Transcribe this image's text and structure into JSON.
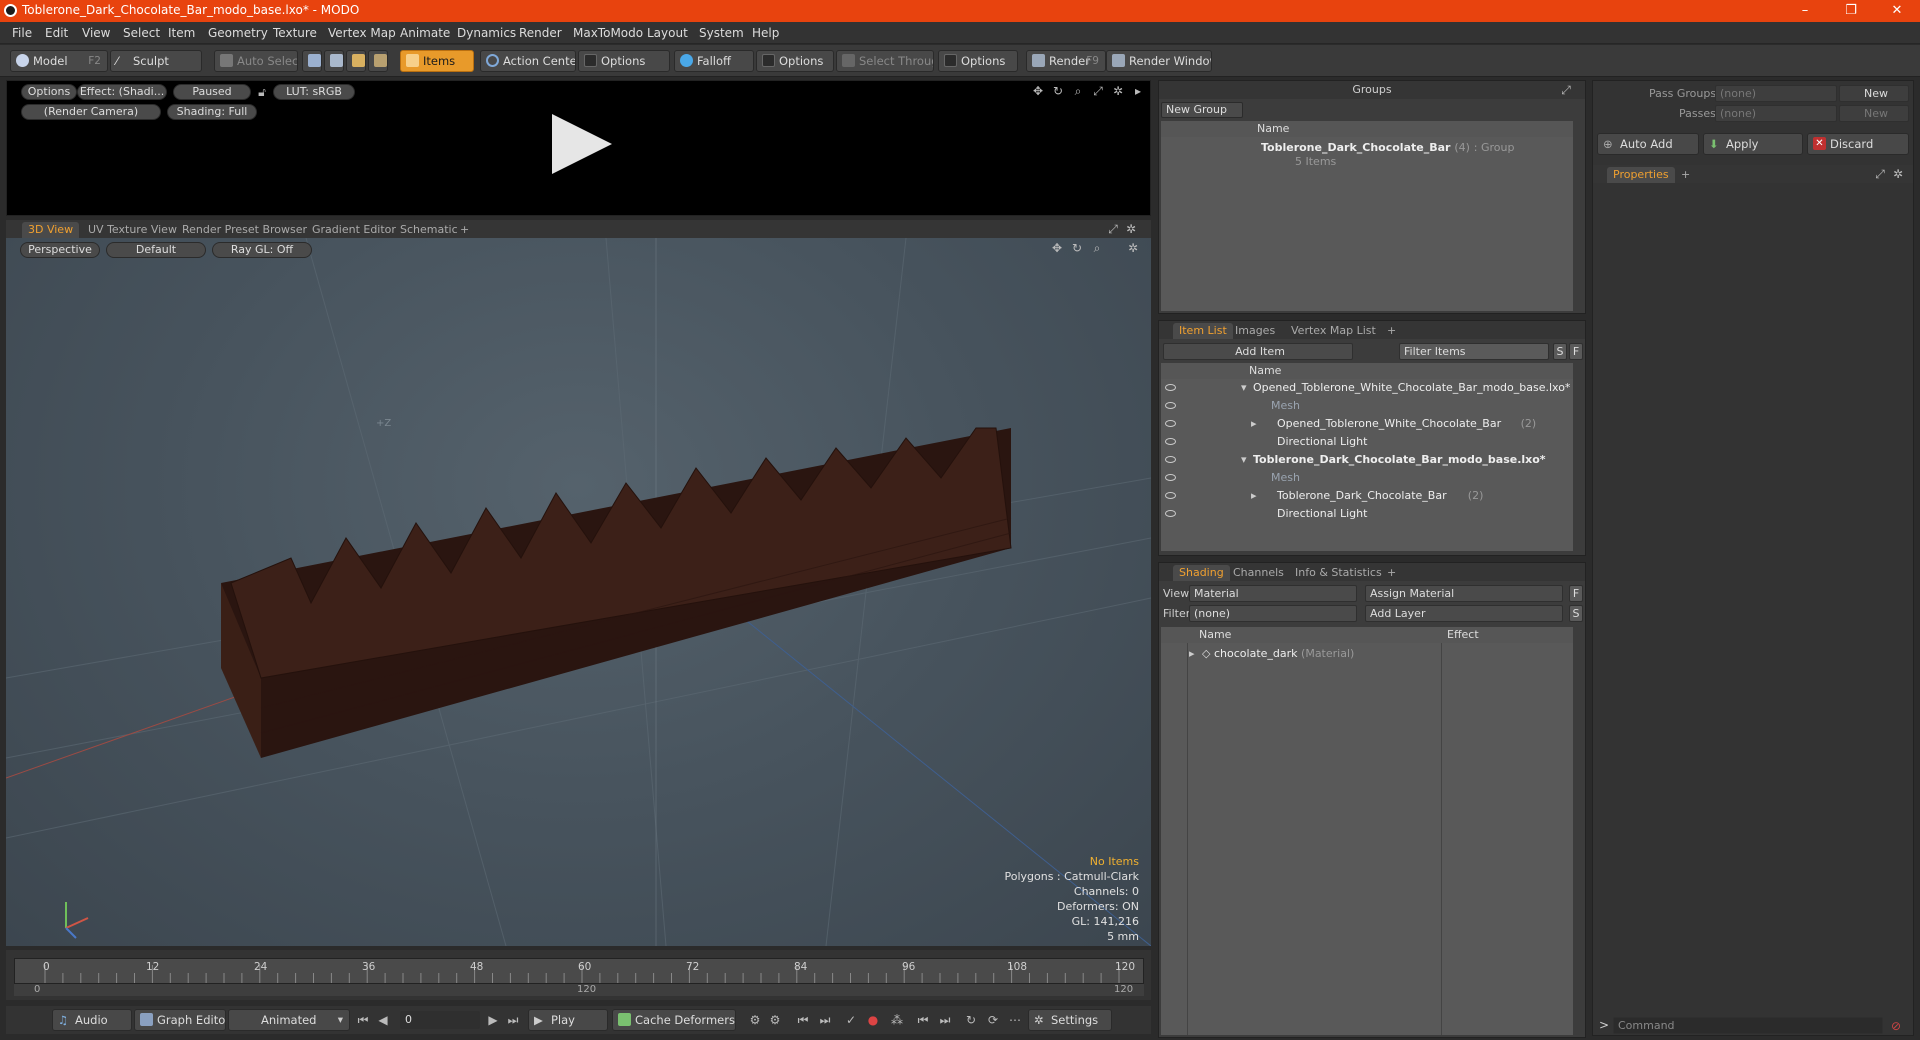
{
  "window": {
    "title": "Toblerone_Dark_Chocolate_Bar_modo_base.lxo* - MODO",
    "controls": [
      "–",
      "❐",
      "✕"
    ]
  },
  "menu": [
    "File",
    "Edit",
    "View",
    "Select",
    "Item",
    "Geometry",
    "Texture",
    "Vertex Map",
    "Animate",
    "Dynamics",
    "Render",
    "MaxToModo",
    "Layout",
    "System",
    "Help"
  ],
  "toolbar": {
    "model": "Model",
    "model_hotkey": "F2",
    "sculpt": "Sculpt",
    "auto_select": "Auto Select",
    "items": "Items",
    "action_center": "Action Center",
    "options1": "Options",
    "falloff": "Falloff",
    "options2": "Options",
    "select_through": "Select Through",
    "options3": "Options",
    "render": "Render",
    "render_hotkey": "F9",
    "render_window": "Render Window"
  },
  "preview": {
    "options": "Options",
    "effect": "Effect: (Shadi...",
    "paused": "Paused",
    "lut": "LUT: sRGB",
    "camera": "(Render Camera)",
    "shading": "Shading: Full"
  },
  "viewport_tabs": [
    "3D View",
    "UV Texture View",
    "Render Preset Browser",
    "Gradient Editor",
    "Schematic",
    "+"
  ],
  "viewport": {
    "perspective": "Perspective",
    "default": "Default",
    "raygl": "Ray GL: Off",
    "axis_label": "+Z",
    "stats": {
      "no_items": "No Items",
      "polygons": "Polygons : Catmull-Clark",
      "channels": "Channels: 0",
      "deformers": "Deformers: ON",
      "gl": "GL: 141,216",
      "unit": "5 mm"
    }
  },
  "timeline": {
    "ticks": [
      "0",
      "12",
      "24",
      "36",
      "48",
      "60",
      "72",
      "84",
      "96",
      "108",
      "120"
    ],
    "range_start": "0",
    "range_mid": "120",
    "range_end": "120"
  },
  "transport": {
    "audio": "Audio",
    "graph_editor": "Graph Editor",
    "animated": "Animated",
    "frame": "0",
    "play": "Play",
    "cache_deformers": "Cache Deformers",
    "settings": "Settings"
  },
  "groups": {
    "title": "Groups",
    "new_group": "New Group",
    "col_name": "Name",
    "item_name": "Toblerone_Dark_Chocolate_Bar",
    "item_count": "(4)",
    "item_type": ": Group",
    "item_sub": "5 Items"
  },
  "passes": {
    "pass_groups_label": "Pass Groups",
    "pass_groups_value": "(none)",
    "passes_label": "Passes",
    "passes_value": "(none)",
    "new1": "New",
    "new2": "New",
    "auto_add": "Auto Add",
    "apply": "Apply",
    "discard": "Discard",
    "properties_tab": "Properties",
    "plus": "+"
  },
  "item_list": {
    "tabs": [
      "Item List",
      "Images",
      "Vertex Map List",
      "+"
    ],
    "add_item": "Add Item",
    "filter_items": "Filter Items",
    "btn_s": "S",
    "btn_f": "F",
    "col_name": "Name",
    "rows": [
      {
        "label": "Opened_Toblerone_White_Chocolate_Bar_modo_base.lxo*",
        "extra": "",
        "indent": 0,
        "bold": false,
        "dim": false,
        "eye": true
      },
      {
        "label": "Mesh",
        "extra": "",
        "indent": 2,
        "bold": false,
        "dim": true,
        "eye": true
      },
      {
        "label": "Opened_Toblerone_White_Chocolate_Bar",
        "extra": "(2)",
        "indent": 1,
        "bold": false,
        "dim": false,
        "eye": true
      },
      {
        "label": "Directional Light",
        "extra": "",
        "indent": 1,
        "bold": false,
        "dim": false,
        "eye": true
      },
      {
        "label": "Toblerone_Dark_Chocolate_Bar_modo_base.lxo*",
        "extra": "",
        "indent": 0,
        "bold": true,
        "dim": false,
        "eye": true
      },
      {
        "label": "Mesh",
        "extra": "",
        "indent": 2,
        "bold": false,
        "dim": true,
        "eye": true
      },
      {
        "label": "Toblerone_Dark_Chocolate_Bar",
        "extra": "(2)",
        "indent": 1,
        "bold": false,
        "dim": false,
        "eye": true
      },
      {
        "label": "Directional Light",
        "extra": "",
        "indent": 1,
        "bold": false,
        "dim": false,
        "eye": true
      }
    ]
  },
  "shading": {
    "tabs": [
      "Shading",
      "Channels",
      "Info & Statistics",
      "+"
    ],
    "view_label": "View",
    "view_value": "Material",
    "assign_material": "Assign Material",
    "filter_label": "Filter",
    "filter_value": "(none)",
    "add_layer": "Add Layer",
    "btn_f": "F",
    "btn_s": "S",
    "col_name": "Name",
    "col_effect": "Effect",
    "material_name": "chocolate_dark",
    "material_type": "(Material)"
  },
  "command": {
    "prompt": ">",
    "placeholder": "Command"
  },
  "colors": {
    "titlebar": "#e8430e",
    "accent": "#e89a2a",
    "chocolate": "#3a1f16"
  }
}
